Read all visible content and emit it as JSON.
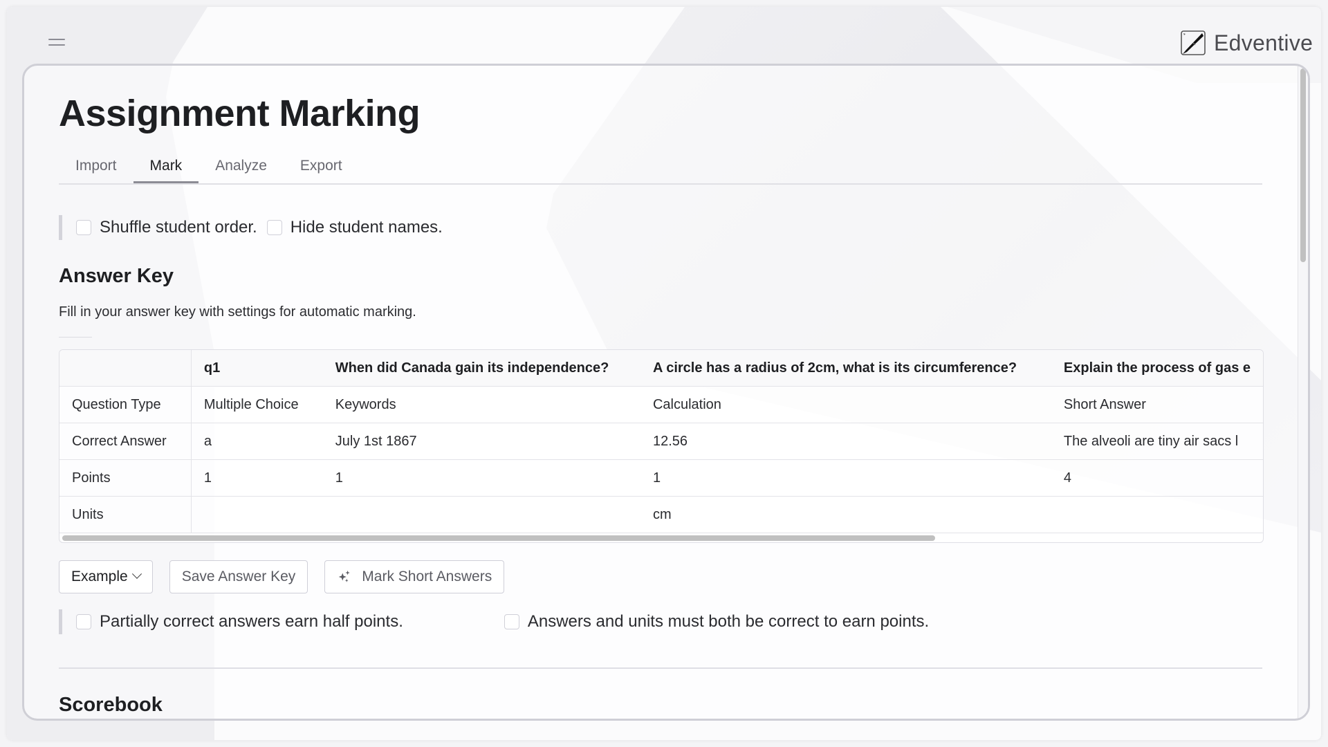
{
  "app": {
    "name": "Edventive"
  },
  "header": {
    "menu_icon": "hamburger-icon",
    "logo_icon": "pen-square-icon"
  },
  "page": {
    "title": "Assignment Marking"
  },
  "tabs": [
    {
      "label": "Import",
      "active": false
    },
    {
      "label": "Mark",
      "active": true
    },
    {
      "label": "Analyze",
      "active": false
    },
    {
      "label": "Export",
      "active": false
    }
  ],
  "options_top": [
    {
      "label": "Shuffle student order.",
      "checked": false
    },
    {
      "label": "Hide student names.",
      "checked": false
    }
  ],
  "answer_key": {
    "title": "Answer Key",
    "description": "Fill in your answer key with settings for automatic marking.",
    "columns": [
      "",
      "q1",
      "When did Canada gain its independence?",
      "A circle has a radius of 2cm, what is its circumference?",
      "Explain the process of gas e"
    ],
    "rows": [
      {
        "label": "Question Type",
        "cells": [
          "Multiple Choice",
          "Keywords",
          "Calculation",
          "Short Answer"
        ]
      },
      {
        "label": "Correct Answer",
        "cells": [
          "a",
          "July 1st 1867",
          "12.56",
          "The alveoli are tiny air sacs l"
        ]
      },
      {
        "label": "Points",
        "cells": [
          "1",
          "1",
          "1",
          "4"
        ]
      },
      {
        "label": "Units",
        "cells": [
          "",
          "",
          "cm",
          ""
        ]
      }
    ],
    "buttons": {
      "example": "Example",
      "save": "Save Answer Key",
      "mark_short": "Mark Short Answers"
    },
    "options": [
      {
        "label": "Partially correct answers earn half points.",
        "checked": false
      },
      {
        "label": "Answers and units must both be correct to earn points.",
        "checked": false
      }
    ]
  },
  "scorebook": {
    "title": "Scorebook"
  }
}
